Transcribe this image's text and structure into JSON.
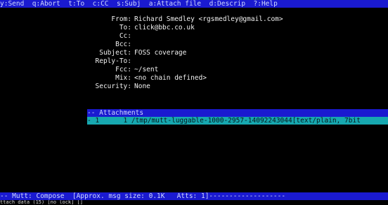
{
  "menu": {
    "send": "y:Send",
    "abort": "q:Abort",
    "to": "t:To",
    "cc": "c:CC",
    "subj": "s:Subj",
    "attach": "a:Attach file",
    "descrip": "d:Descrip",
    "help": "?:Help"
  },
  "headers": [
    {
      "label": "From:",
      "value": "Richard Smedley <rgsmedley@gmail.com>"
    },
    {
      "label": "To:",
      "value": "click@bbc.co.uk"
    },
    {
      "label": "Cc:",
      "value": ""
    },
    {
      "label": "Bcc:",
      "value": ""
    },
    {
      "label": "Subject:",
      "value": "FOSS coverage"
    },
    {
      "label": "Reply-To:",
      "value": ""
    },
    {
      "label": "Fcc:",
      "value": "~/sent"
    },
    {
      "label": "Mix:",
      "value": "<no chain defined>"
    },
    {
      "label": "Security:",
      "value": "None"
    }
  ],
  "attachments": {
    "separator": "-- Attachments",
    "row": "- 1      1 /tmp/mutt-luggable-1000-2957-14092243044[text/plain, 7bit"
  },
  "status": {
    "text": "-- Mutt: Compose  [Approx. msg size: 0.1K   Atts: 1]-------------------"
  },
  "bottom_line": "ttach data (15) [no lock] []",
  "colors": {
    "bar_blue": "#1a1ad0",
    "selection_teal": "#17a8b0",
    "background": "#000000"
  }
}
